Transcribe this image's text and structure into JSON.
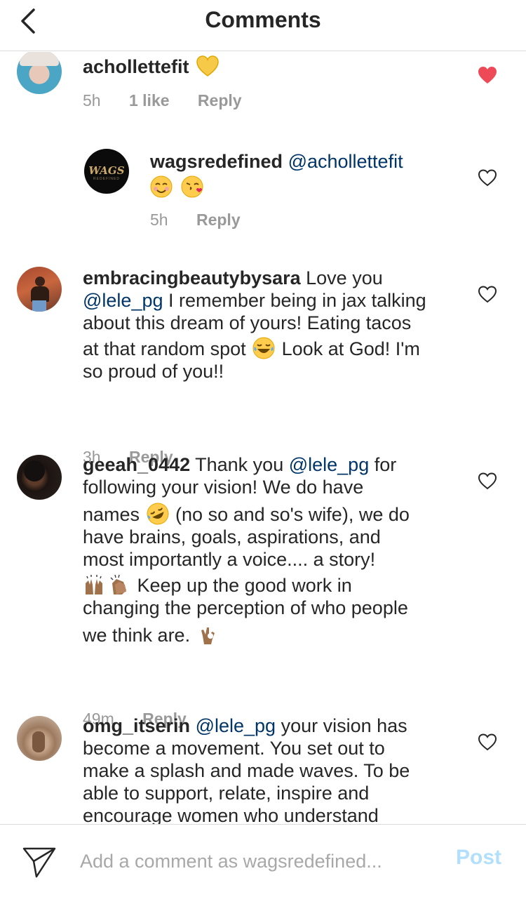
{
  "header": {
    "title": "Comments",
    "back_icon": "chevron-left-icon"
  },
  "comments": [
    {
      "username": "achollettefit",
      "text": "",
      "emoji": [
        "yellow-heart"
      ],
      "time": "5h",
      "likes": "1 like",
      "reply": "Reply",
      "liked": true
    },
    {
      "username": "wagsredefined",
      "mention": "@achollettefit",
      "emoji": [
        "smiling-face",
        "face-blowing-kiss"
      ],
      "time": "5h",
      "reply": "Reply",
      "liked": false,
      "avatar_text": "WAGS",
      "avatar_subtext": "REDEFINED"
    },
    {
      "username": "embracingbeautybysara",
      "text_a": " Love you",
      "mention": "@lele_pg",
      "text_b": " I remember being in jax talking",
      "line3": "about this dream of yours! Eating tacos",
      "line4a": "at that random spot ",
      "line4b": " Look at God! I'm",
      "line5": "so proud of you!!",
      "time": "3h",
      "reply": "Reply",
      "liked": false
    },
    {
      "username": "geeah_0442",
      "text_a": " Thank you ",
      "mention": "@lele_pg",
      "text_b": " for",
      "line2": "following your vision! We do have",
      "line3a": "names ",
      "line3b": " (no so and so's wife), we do",
      "line4": "have brains, goals, aspirations, and",
      "line5": "most importantly a voice.... a story!",
      "line6": " Keep up the good work in",
      "line7": "changing the perception of who people",
      "line8": "we think are. ",
      "time": "49m",
      "reply": "Reply",
      "liked": false
    },
    {
      "username": "omg_itserin",
      "mention": "@lele_pg",
      "text_a": " your vision has",
      "line2": "become a movement. You set out to",
      "line3": "make a splash and made waves. To be",
      "line4": "able to support, relate, inspire and",
      "line5": "encourage women who understand",
      "liked": false
    }
  ],
  "composer": {
    "placeholder": "Add a comment as wagsredefined...",
    "post_label": "Post",
    "send_icon": "paper-plane-icon"
  },
  "colors": {
    "text": "#262626",
    "meta": "#999999",
    "mention": "#003569",
    "liked_heart": "#ed4956",
    "post_disabled": "#b2dffc",
    "divider": "#dbdbdb"
  }
}
